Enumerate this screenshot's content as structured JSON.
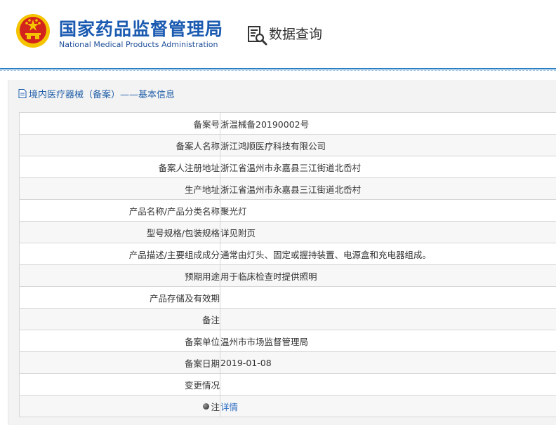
{
  "header": {
    "org_name_cn": "国家药品监督管理局",
    "org_name_en": "National Medical Products Administration",
    "query_label": "数据查询"
  },
  "section": {
    "title": "境内医疗器械（备案）——基本信息"
  },
  "rows": [
    {
      "label": "备案号",
      "value": "浙温械备20190002号"
    },
    {
      "label": "备案人名称",
      "value": "浙江鸿顺医疗科技有限公司"
    },
    {
      "label": "备案人注册地址",
      "value": "浙江省温州市永嘉县三江街道北岙村"
    },
    {
      "label": "生产地址",
      "value": "浙江省温州市永嘉县三江街道北岙村"
    },
    {
      "label": "产品名称/产品分类名称",
      "value": "聚光灯"
    },
    {
      "label": "型号规格/包装规格",
      "value": "详见附页"
    },
    {
      "label": "产品描述/主要组成成分",
      "value": "通常由灯头、固定或握持装置、电源盒和充电器组成。"
    },
    {
      "label": "预期用途",
      "value": "用于临床检查时提供照明"
    },
    {
      "label": "产品存储及有效期",
      "value": ""
    },
    {
      "label": "备注",
      "value": ""
    },
    {
      "label": "备案单位",
      "value": "温州市市场监督管理局"
    },
    {
      "label": "备案日期",
      "value": "2019-01-08"
    },
    {
      "label": "变更情况",
      "value": ""
    }
  ],
  "note_row": {
    "label": "注",
    "link_text": "详情"
  },
  "colors": {
    "brand_blue": "#1a5ab0",
    "divider_blue": "#2c7fc4",
    "link_blue": "#2c6ec2",
    "emblem_red": "#d2231c",
    "emblem_gold": "#f5c400"
  },
  "icons": {
    "emblem": "national-emblem-icon",
    "query": "search-document-icon",
    "section": "document-icon",
    "note": "pin-icon"
  }
}
